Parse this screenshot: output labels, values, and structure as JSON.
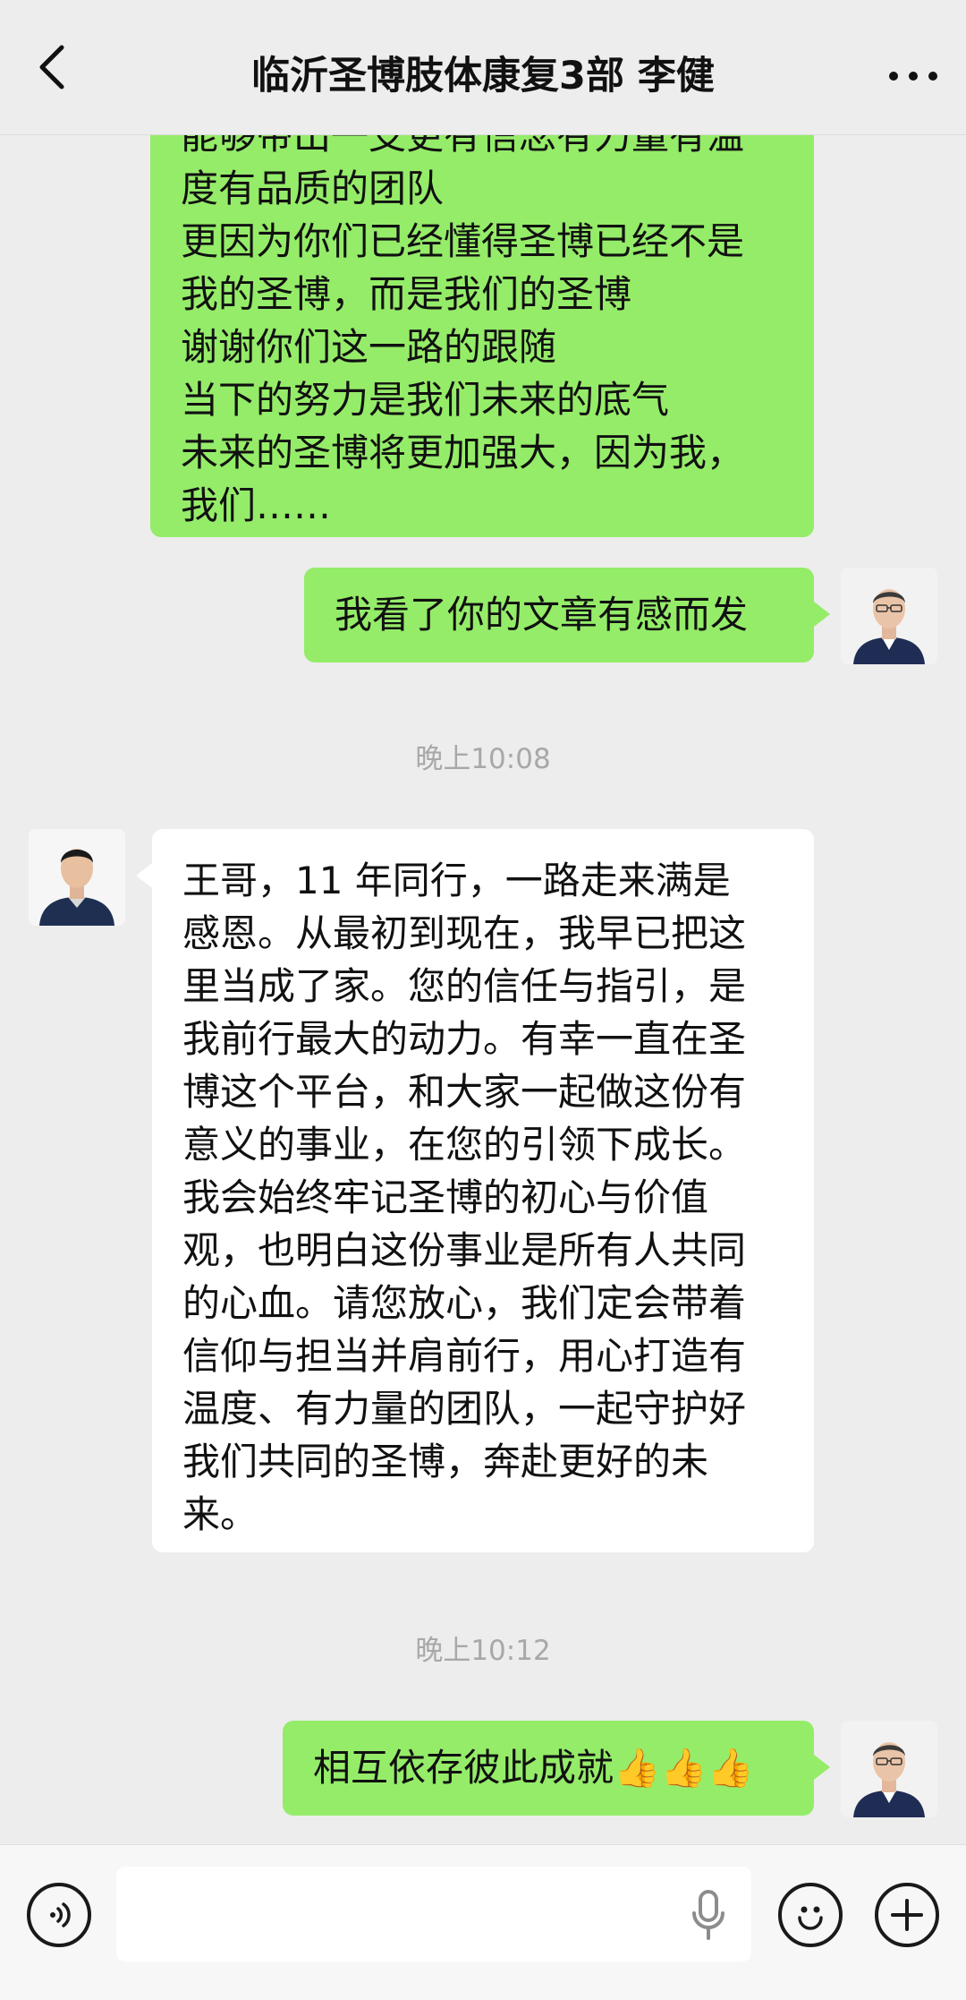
{
  "header": {
    "title": "临沂圣博肢体康复3部  李健",
    "back_icon": "chevron-left-icon",
    "more_icon": "more-dots-icon"
  },
  "messages": [
    {
      "id": "m1",
      "side": "right",
      "text": "能够带出一支更有信念有力量有温\n度有品质的团队\n更因为你们已经懂得圣博已经不是\n我的圣博，而是我们的圣博\n谢谢你们这一路的跟随\n当下的努力是我们未来的底气\n未来的圣博将更加强大，因为我，\n我们……"
    },
    {
      "id": "m2",
      "side": "right",
      "text": "我看了你的文章有感而发"
    },
    {
      "id": "t1",
      "type": "timestamp",
      "text": "晚上10:08"
    },
    {
      "id": "m3",
      "side": "left",
      "text": "王哥，11 年同行，一路走来满是\n感恩。从最初到现在，我早已把这\n里当成了家。您的信任与指引，是\n我前行最大的动力。有幸一直在圣\n博这个平台，和大家一起做这份有\n意义的事业，在您的引领下成长。\n我会始终牢记圣博的初心与价值\n观，也明白这份事业是所有人共同\n的心血。请您放心，我们定会带着\n信仰与担当并肩前行，用心打造有\n温度、有力量的团队，一起守护好\n我们共同的圣博，奔赴更好的未\n来。"
    },
    {
      "id": "t2",
      "type": "timestamp",
      "text": "晚上10:12"
    },
    {
      "id": "m4",
      "side": "right",
      "text": "相互依存彼此成就👍👍👍"
    }
  ],
  "input": {
    "placeholder": "",
    "value": "",
    "voice_icon": "voice-icon",
    "mic_icon": "microphone-icon",
    "emoji_icon": "emoji-icon",
    "add_icon": "plus-icon"
  },
  "colors": {
    "sent_bubble": "#95ec69",
    "received_bubble": "#ffffff",
    "background": "#ededed",
    "timestamp": "#a8a8a8"
  }
}
